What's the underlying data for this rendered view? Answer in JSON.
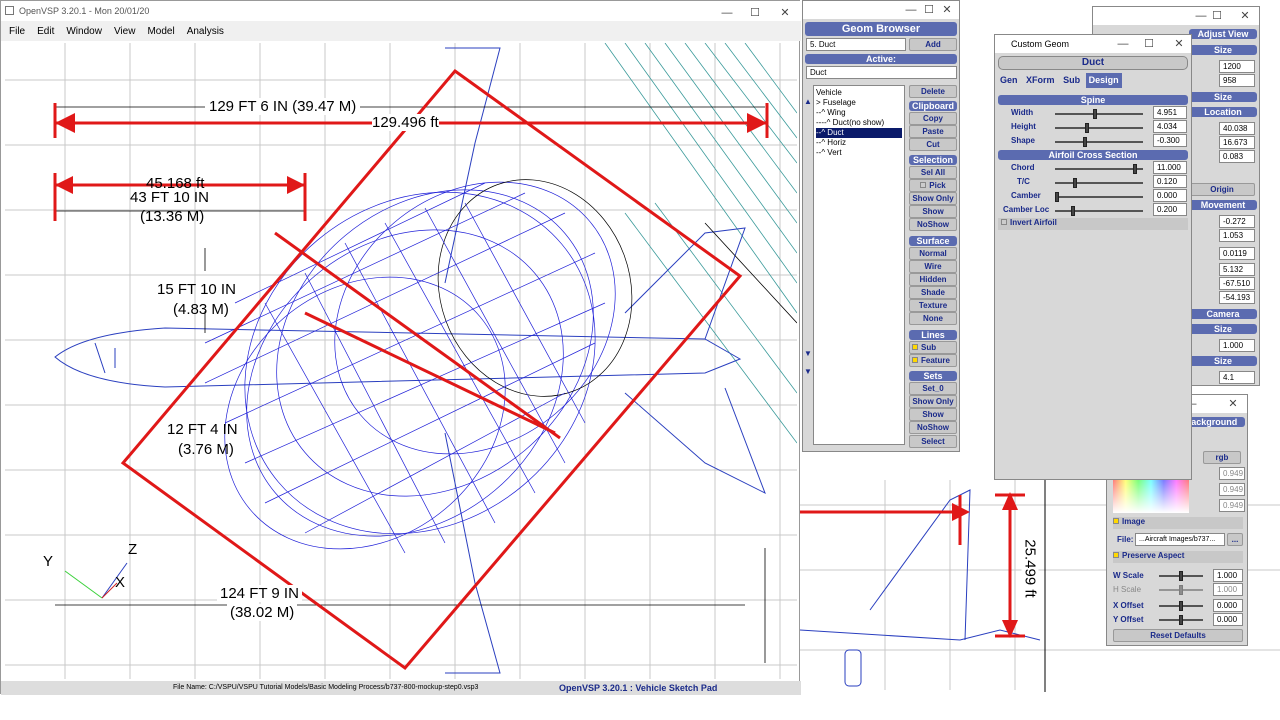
{
  "main_window": {
    "title": "OpenVSP 3.20.1 - Mon 20/01/20",
    "menu": [
      "File",
      "Edit",
      "Window",
      "View",
      "Model",
      "Analysis"
    ],
    "status_filename": "File Name: C:/VSPU/VSPU Tutorial Models/Basic Modeling Process/b737-800-mockup-step0.vsp3",
    "status_title": "OpenVSP 3.20.1 : Vehicle Sketch Pad"
  },
  "sketch": {
    "dim_129": "129  FT  6  IN  (39.47  M)",
    "dim_129_red": "129.496 ft",
    "dim_45": "45.168 ft",
    "dim_43a": "43  FT  10  IN",
    "dim_43b": "(13.36  M)",
    "dim_15a": "15  FT  10  IN",
    "dim_15b": "(4.83  M)",
    "dim_12a": "12  FT  4  IN",
    "dim_12b": "(3.76  M)",
    "dim_124a": "124  FT  9  IN",
    "dim_124b": "(38.02  M)",
    "axis_y": "Y",
    "axis_z": "Z",
    "axis_x": "X",
    "dim_25": "25.499 ft"
  },
  "geom_browser": {
    "title": "Geom Browser",
    "geom_select": "5. Duct",
    "add": "Add",
    "active_label": "Active:",
    "active_value": "Duct",
    "tree": [
      "Vehicle",
      "> Fuselage",
      "--^ Wing",
      "----^ Duct(no show)",
      "--^ Duct",
      "--^ Horiz",
      "--^ Vert"
    ],
    "delete": "Delete",
    "clipboard": "Clipboard",
    "copy": "Copy",
    "paste": "Paste",
    "cut": "Cut",
    "selection": "Selection",
    "sel_all": "Sel All",
    "pick": "Pick",
    "show_only": "Show Only",
    "show": "Show",
    "noshow": "NoShow",
    "surface": "Surface",
    "normal": "Normal",
    "wire": "Wire",
    "hidden": "Hidden",
    "shade": "Shade",
    "texture": "Texture",
    "none": "None",
    "lines": "Lines",
    "sub": "Sub",
    "feature": "Feature",
    "sets": "Sets",
    "set0": "Set_0",
    "sets_show_only": "Show Only",
    "sets_show": "Show",
    "sets_noshow": "NoShow",
    "select": "Select"
  },
  "custom_geom": {
    "title": "Custom Geom",
    "name": "Duct",
    "tabs": [
      "Gen",
      "XForm",
      "Sub",
      "Design"
    ],
    "spine": "Spine",
    "width_label": "Width",
    "width": "4.951",
    "height_label": "Height",
    "height": "4.034",
    "shape_label": "Shape",
    "shape": "-0.300",
    "airfoil": "Airfoil Cross Section",
    "chord_label": "Chord",
    "chord": "11.000",
    "tc_label": "T/C",
    "tc": "0.120",
    "camber_label": "Camber",
    "camber": "0.000",
    "camberloc_label": "Camber Loc",
    "camberloc": "0.200",
    "invert": "Invert Airfoil"
  },
  "adjust_view": {
    "title": "Adjust View",
    "size": "Size",
    "w": "1200",
    "h": "958",
    "size2": "Size",
    "location": "Location",
    "lx": "40.038",
    "ly": "16.673",
    "lz": "0.083",
    "origin": "Origin",
    "movement": "Movement",
    "m1": "-0.272",
    "m2": "1.053",
    "m3": "0.0119",
    "m4": "5.132",
    "m5": "-67.510",
    "m6": "-54.193",
    "camera": "Camera",
    "size3": "Size",
    "s3": "1.000",
    "size4": "Size",
    "s4": "4.1"
  },
  "background": {
    "title": "Background",
    "rgb": "rgb",
    "v1": "0.949",
    "v2": "0.949",
    "v3": "0.949",
    "image": "Image",
    "file_label": "File:",
    "file": "...Aircraft Images/b737...",
    "dots": "...",
    "preserve": "Preserve Aspect",
    "wscale_label": "W Scale",
    "wscale": "1.000",
    "hscale_label": "H Scale",
    "hscale": "1.000",
    "xoff_label": "X Offset",
    "xoff": "0.000",
    "yoff_label": "Y Offset",
    "yoff": "0.000",
    "reset": "Reset Defaults"
  }
}
